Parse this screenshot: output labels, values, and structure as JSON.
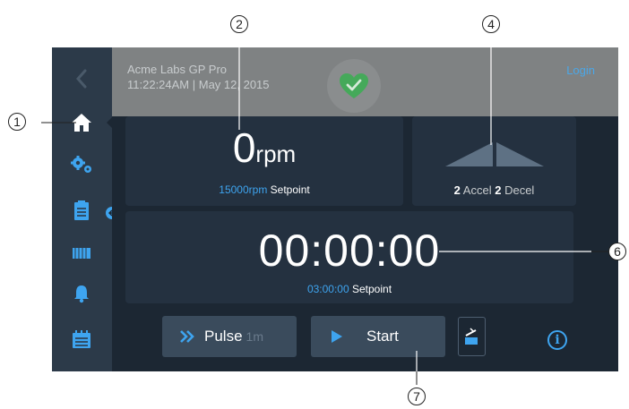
{
  "header": {
    "app_name": "Acme Labs GP Pro",
    "datetime": "11:22:24AM | May 12, 2015",
    "login_label": "Login"
  },
  "sidebar": {
    "items": [
      {
        "icon": "back-chevron-icon"
      },
      {
        "icon": "home-icon"
      },
      {
        "icon": "gears-icon"
      },
      {
        "icon": "clipboard-icon"
      },
      {
        "icon": "rotor-icon"
      },
      {
        "icon": "bell-icon"
      },
      {
        "icon": "calendar-list-icon"
      }
    ]
  },
  "speed": {
    "value": "0",
    "unit": "rpm",
    "setpoint_value": "15000rpm",
    "setpoint_label": "Setpoint"
  },
  "accel": {
    "accel_value": "2",
    "accel_label": "Accel",
    "decel_value": "2",
    "decel_label": "Decel"
  },
  "timer": {
    "value": "00:00:00",
    "setpoint_value": "03:00:00",
    "setpoint_label": "Setpoint"
  },
  "buttons": {
    "pulse_label": "Pulse",
    "pulse_duration": "1m",
    "start_label": "Start"
  },
  "callouts": [
    "1",
    "2",
    "4",
    "6",
    "7"
  ],
  "colors": {
    "accent": "#3ea4ef",
    "health": "#45a95a",
    "screen_bg": "#1f2b37",
    "header_bg": "#7f8283"
  }
}
